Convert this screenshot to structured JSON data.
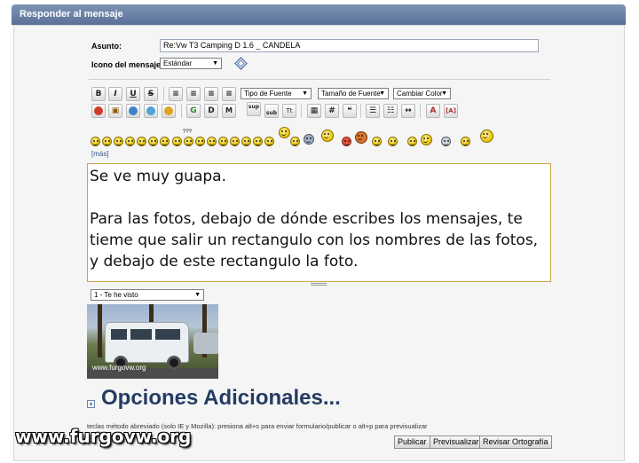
{
  "header": {
    "title": "Responder al mensaje"
  },
  "form": {
    "subject_label": "Asunto:",
    "subject_value": "Re:Vw T3 Camping D 1.6 _ CANDELA",
    "icon_label": "Icono del mensaje:",
    "icon_value": "Estándar"
  },
  "toolbar": {
    "bold": "B",
    "italic": "I",
    "underline": "U",
    "strike": "S",
    "font_type": "Tipo de Fuente",
    "font_size": "Tamaño de Fuente",
    "color": "Cambiar Color",
    "sup": "sup",
    "sub": "sub",
    "tt": "Tt"
  },
  "smilies": {
    "more_link": "[más]",
    "qqq": "???"
  },
  "editor": {
    "text": "Se ve muy guapa.\n\nPara las fotos, debajo de dónde escribes los mensajes, te tieme que salir un rectangulo con los nombres de las fotos, y debajo de este rectangulo la foto."
  },
  "attachments": {
    "selected": "1 - Te he visto"
  },
  "photo": {
    "watermark": "www.furgovw.org"
  },
  "options": {
    "toggle": "+",
    "title": "Opciones Adicionales..."
  },
  "hint": "teclas método abreviado (solo IE y Mozilla): presiona alt+s para enviar formulario/publicar o alt+p para previsualizar",
  "buttons": {
    "publish": "Publicar",
    "preview": "Previsualizar",
    "spellcheck": "Revisar Ortografía"
  },
  "site_watermark": "www.furgovw.org",
  "colors": {
    "header": "#6b82a8",
    "title": "#253c63",
    "editor_border": "#c9a54a"
  }
}
